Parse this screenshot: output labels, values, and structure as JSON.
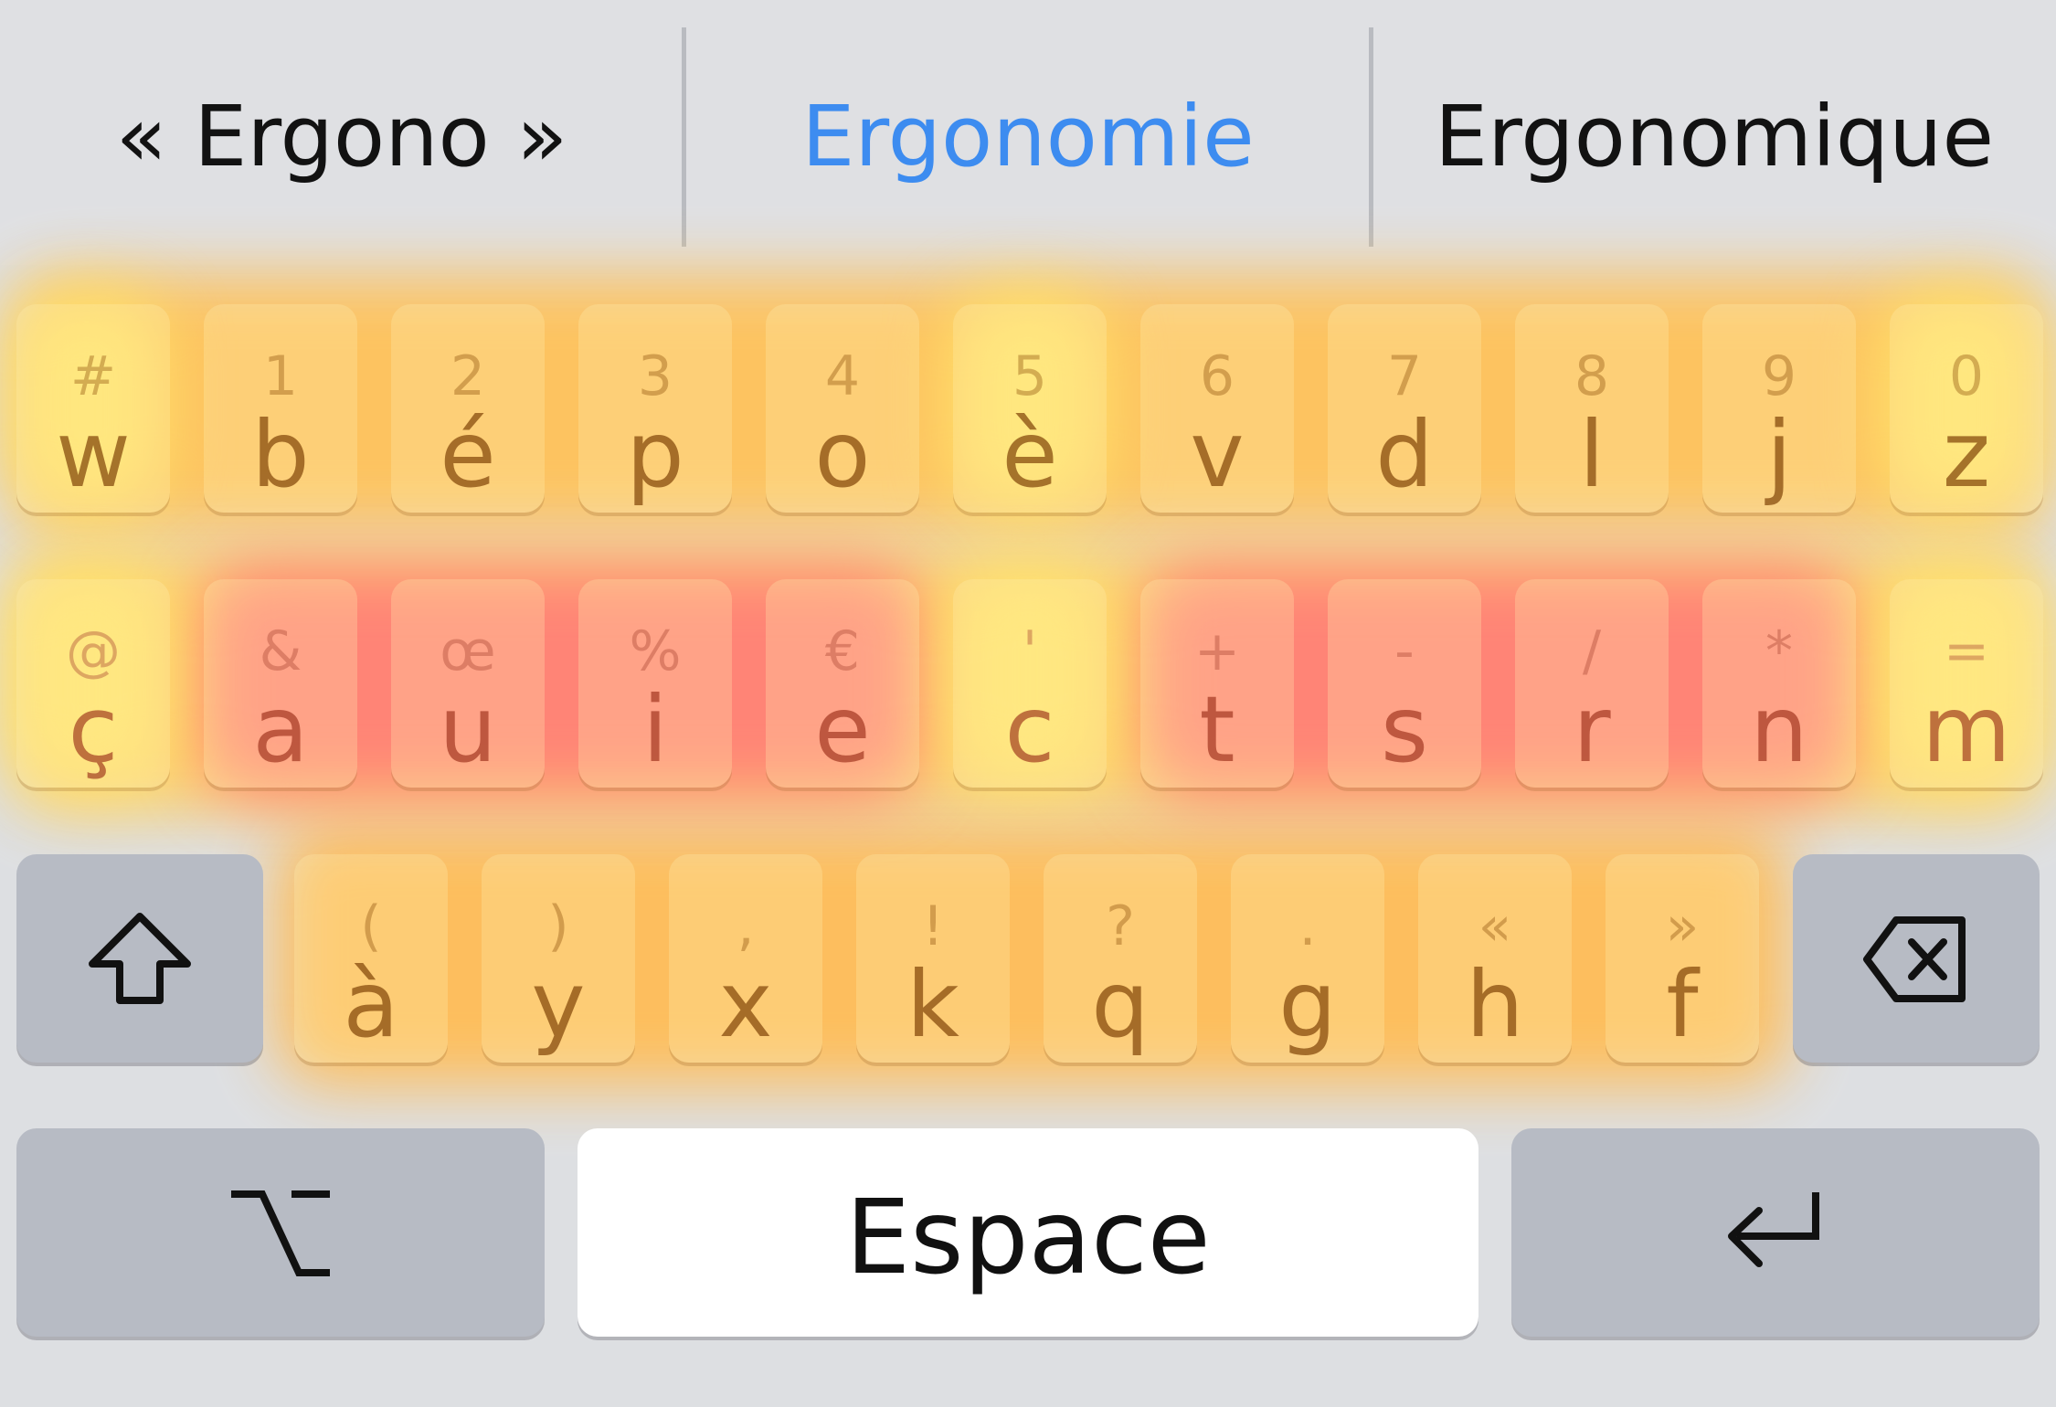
{
  "suggestions": [
    {
      "text": "« Ergono »",
      "selected": false
    },
    {
      "text": "Ergonomie",
      "selected": true
    },
    {
      "text": "Ergonomique",
      "selected": false
    }
  ],
  "colors": {
    "selected_suggestion": "#3d8cf0",
    "heat_hot": "#ff7f6f",
    "heat_warm": "#ffb347",
    "heat_cool": "#ffe266",
    "function_key": "#b7bbc4"
  },
  "rows": [
    [
      {
        "alt": "#",
        "main": "w"
      },
      {
        "alt": "1",
        "main": "b"
      },
      {
        "alt": "2",
        "main": "é"
      },
      {
        "alt": "3",
        "main": "p"
      },
      {
        "alt": "4",
        "main": "o"
      },
      {
        "alt": "5",
        "main": "è"
      },
      {
        "alt": "6",
        "main": "v"
      },
      {
        "alt": "7",
        "main": "d"
      },
      {
        "alt": "8",
        "main": "l"
      },
      {
        "alt": "9",
        "main": "j"
      },
      {
        "alt": "0",
        "main": "z"
      }
    ],
    [
      {
        "alt": "@",
        "main": "ç"
      },
      {
        "alt": "&",
        "main": "a"
      },
      {
        "alt": "œ",
        "main": "u"
      },
      {
        "alt": "%",
        "main": "i"
      },
      {
        "alt": "€",
        "main": "e"
      },
      {
        "alt": "'",
        "main": "c"
      },
      {
        "alt": "+",
        "main": "t"
      },
      {
        "alt": "-",
        "main": "s"
      },
      {
        "alt": "/",
        "main": "r"
      },
      {
        "alt": "*",
        "main": "n"
      },
      {
        "alt": "=",
        "main": "m"
      }
    ],
    [
      {
        "alt": "(",
        "main": "à"
      },
      {
        "alt": ")",
        "main": "y"
      },
      {
        "alt": ",",
        "main": "x"
      },
      {
        "alt": "!",
        "main": "k"
      },
      {
        "alt": "?",
        "main": "q"
      },
      {
        "alt": ".",
        "main": "g"
      },
      {
        "alt": "«",
        "main": "h"
      },
      {
        "alt": "»",
        "main": "f"
      }
    ]
  ],
  "function_keys": {
    "shift": {
      "icon": "shift-arrow-icon"
    },
    "delete": {
      "icon": "delete-backspace-icon"
    },
    "option": {
      "icon": "option-alt-icon"
    },
    "return": {
      "icon": "return-arrow-icon"
    }
  },
  "space": {
    "label": "Espace"
  }
}
